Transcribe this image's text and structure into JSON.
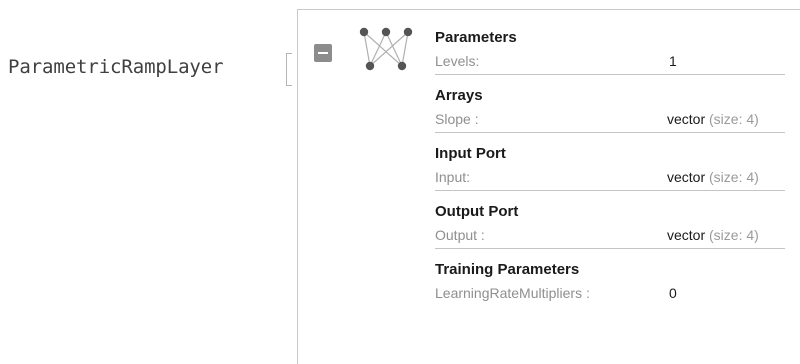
{
  "head": {
    "text": "ParametricRampLayer"
  },
  "icons": {
    "collapse": "minus-box-icon",
    "network": "neural-network-icon"
  },
  "colors": {
    "collapse_button": "#8c8c8c",
    "network_node": "#555555",
    "network_edge": "#b0b0b0"
  },
  "panel": {
    "sections": [
      {
        "title": "Parameters",
        "rows": [
          {
            "key": "Levels:",
            "value": "1"
          }
        ]
      },
      {
        "title": "Arrays",
        "rows": [
          {
            "key": "Slope :",
            "value_main": "vector",
            "value_detail": "(size: 4)"
          }
        ]
      },
      {
        "title": "Input Port",
        "rows": [
          {
            "key": "Input:",
            "value_main": "vector",
            "value_detail": "(size: 4)"
          }
        ]
      },
      {
        "title": "Output Port",
        "rows": [
          {
            "key": "Output :",
            "value_main": "vector",
            "value_detail": "(size: 4)"
          }
        ]
      },
      {
        "title": "Training Parameters",
        "rows": [
          {
            "key": "LearningRateMultipliers :",
            "value": "0"
          }
        ]
      }
    ]
  }
}
